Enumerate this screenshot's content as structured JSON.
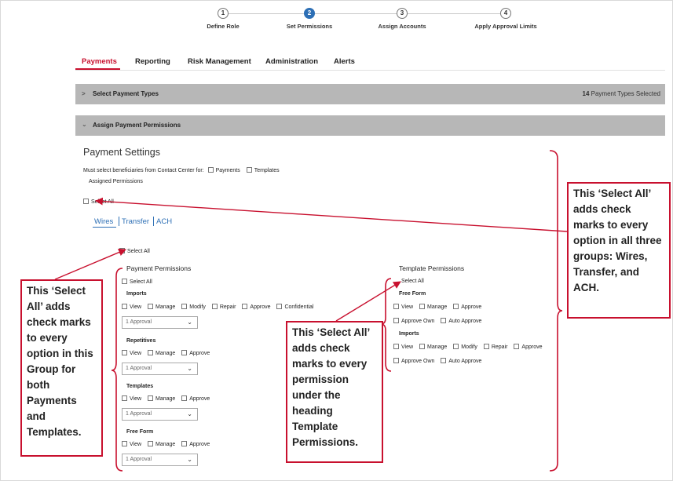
{
  "stepper": {
    "steps": [
      {
        "number": "1",
        "label": "Define Role",
        "active": false
      },
      {
        "number": "2",
        "label": "Set Permissions",
        "active": true
      },
      {
        "number": "3",
        "label": "Assign Accounts",
        "active": false
      },
      {
        "number": "4",
        "label": "Apply Approval Limits",
        "active": false
      }
    ]
  },
  "tabs": [
    "Payments",
    "Reporting",
    "Risk Management",
    "Administration",
    "Alerts"
  ],
  "select_payment_types": {
    "title": "Select Payment Types",
    "count": "14",
    "count_suffix": "Payment Types Selected"
  },
  "assign_payment_permissions": {
    "title": "Assign Payment Permissions"
  },
  "payment_settings": {
    "heading": "Payment Settings",
    "beneficiaries_text": "Must select beneficiaries from Contact Center for:",
    "beneficiaries_options": [
      "Payments",
      "Templates"
    ],
    "assigned_permissions": "Assigned Permissions",
    "select_all": "Select All"
  },
  "subtabs": [
    "Wires",
    "Transfer",
    "ACH"
  ],
  "group_select_all": "Select All",
  "payment_permissions": {
    "heading": "Payment Permissions",
    "select_all": "Select All",
    "sections": [
      {
        "title": "Imports",
        "options": [
          "View",
          "Manage",
          "Modify",
          "Repair",
          "Approve",
          "Confidential"
        ],
        "select_value": "1 Approval"
      },
      {
        "title": "Repetitives",
        "options": [
          "View",
          "Manage",
          "Approve"
        ],
        "select_value": "1 Approval"
      },
      {
        "title": "Templates",
        "options": [
          "View",
          "Manage",
          "Approve"
        ],
        "select_value": "1 Approval"
      },
      {
        "title": "Free Form",
        "options": [
          "View",
          "Manage",
          "Approve"
        ],
        "select_value": "1 Approval"
      }
    ]
  },
  "template_permissions": {
    "heading": "Template Permissions",
    "select_all": "Select All",
    "sections": [
      {
        "title": "Free Form",
        "rows": [
          [
            "View",
            "Manage",
            "Approve"
          ],
          [
            "Approve Own",
            "Auto Approve"
          ]
        ]
      },
      {
        "title": "Imports",
        "rows": [
          [
            "View",
            "Manage",
            "Modify",
            "Repair",
            "Approve"
          ],
          [
            "Approve Own",
            "Auto Approve"
          ]
        ]
      }
    ]
  },
  "callouts": {
    "right": "This ‘Select All’ adds check marks to every option in all three groups: Wires, Transfer, and ACH.",
    "left": "This ‘Select All’ adds check marks to every option in this Group for both Payments and Templates.",
    "middle": "This ‘Select All’ adds check marks to every permission under the heading Template Permissions."
  },
  "colors": {
    "accent_red": "#c8102e",
    "link_blue": "#2d6fb5",
    "bar_gray": "#b7b7b7"
  },
  "icons": [
    "chevron-right-icon",
    "chevron-down-icon",
    "caret-down-icon",
    "checkbox-icon"
  ]
}
